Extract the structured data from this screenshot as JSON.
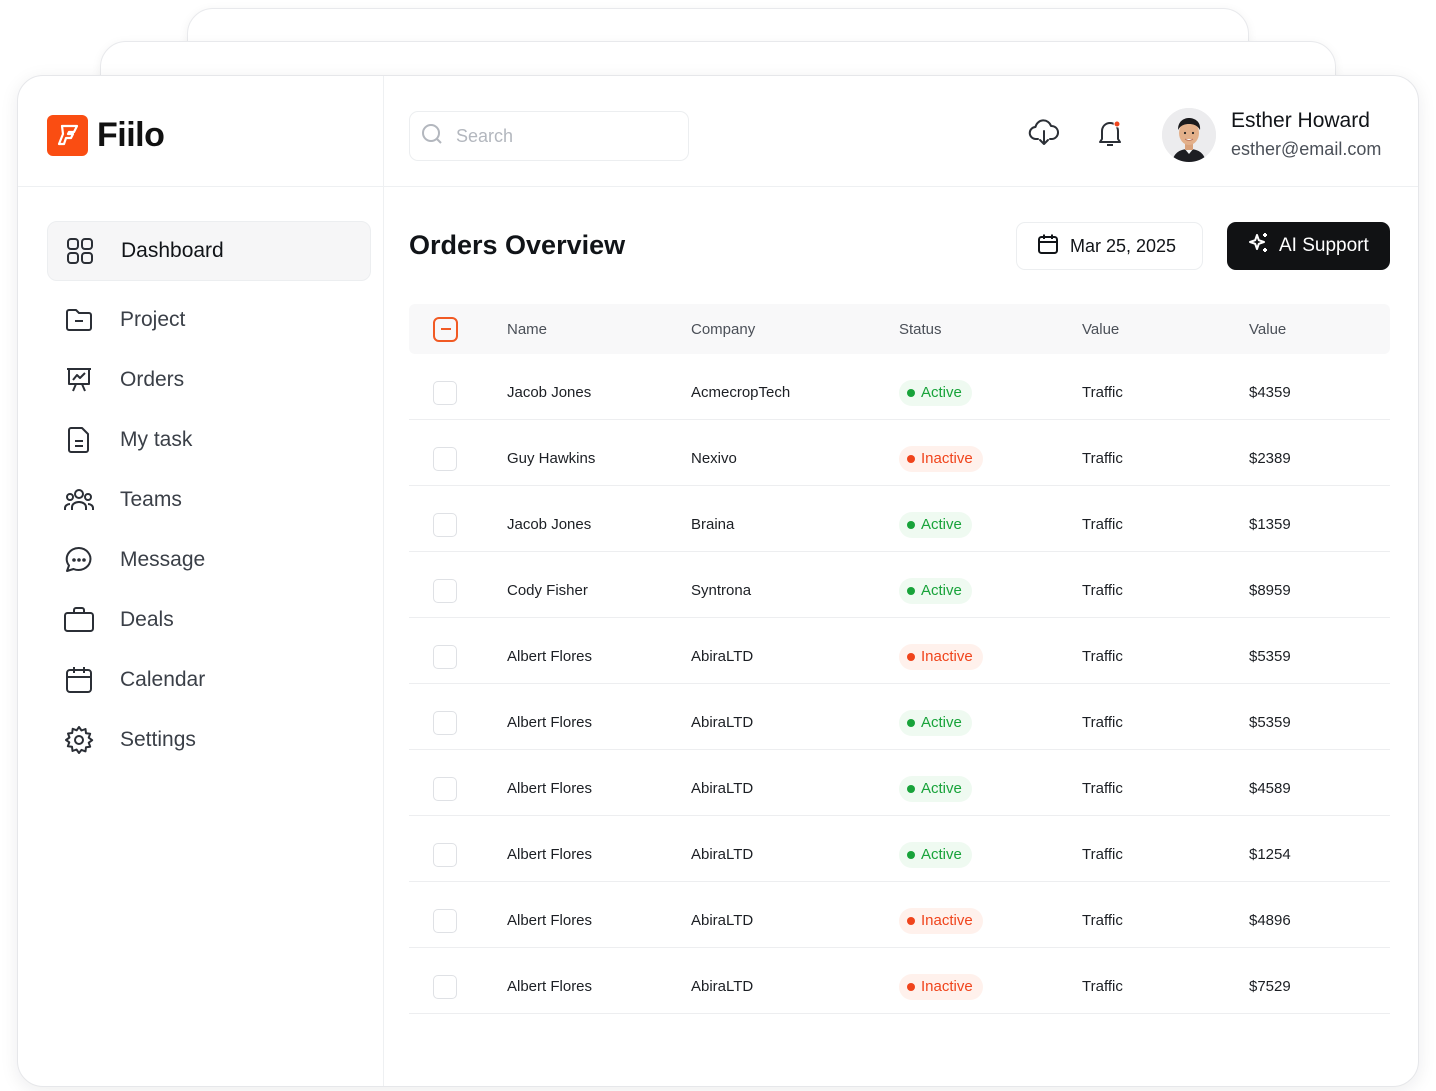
{
  "brand": {
    "name": "Fiilo",
    "accent": "#FA4D12"
  },
  "sidebar": {
    "items": [
      {
        "label": "Dashboard",
        "icon": "grid-icon",
        "active": true
      },
      {
        "label": "Project",
        "icon": "folder-icon"
      },
      {
        "label": "Orders",
        "icon": "presentation-chart-icon"
      },
      {
        "label": "My task",
        "icon": "document-icon"
      },
      {
        "label": "Teams",
        "icon": "users-icon"
      },
      {
        "label": "Message",
        "icon": "chat-bubble-icon"
      },
      {
        "label": "Deals",
        "icon": "briefcase-icon"
      },
      {
        "label": "Calendar",
        "icon": "calendar-icon"
      },
      {
        "label": "Settings",
        "icon": "gear-icon"
      }
    ]
  },
  "header": {
    "search": {
      "placeholder": "Search",
      "value": ""
    },
    "user": {
      "name": "Esther Howard",
      "email": "esther@email.com"
    }
  },
  "main": {
    "title": "Orders Overview",
    "date": "Mar 25, 2025",
    "ai_button": "AI Support",
    "table": {
      "columns": [
        "Name",
        "Company",
        "Status",
        "Value",
        "Value"
      ],
      "rows": [
        {
          "name": "Jacob Jones",
          "company": "AcmecropTech",
          "status": "Active",
          "type": "Traffic",
          "value": "$4359"
        },
        {
          "name": "Guy Hawkins",
          "company": "Nexivo",
          "status": "Inactive",
          "type": "Traffic",
          "value": "$2389"
        },
        {
          "name": "Jacob Jones",
          "company": "Braina",
          "status": "Active",
          "type": "Traffic",
          "value": "$1359"
        },
        {
          "name": "Cody Fisher",
          "company": "Syntrona",
          "status": "Active",
          "type": "Traffic",
          "value": "$8959"
        },
        {
          "name": "Albert Flores",
          "company": "AbiraLTD",
          "status": "Inactive",
          "type": "Traffic",
          "value": "$5359"
        },
        {
          "name": "Albert Flores",
          "company": "AbiraLTD",
          "status": "Active",
          "type": "Traffic",
          "value": "$5359"
        },
        {
          "name": "Albert Flores",
          "company": "AbiraLTD",
          "status": "Active",
          "type": "Traffic",
          "value": "$4589"
        },
        {
          "name": "Albert Flores",
          "company": "AbiraLTD",
          "status": "Active",
          "type": "Traffic",
          "value": "$1254"
        },
        {
          "name": "Albert Flores",
          "company": "AbiraLTD",
          "status": "Inactive",
          "type": "Traffic",
          "value": "$4896"
        },
        {
          "name": "Albert Flores",
          "company": "AbiraLTD",
          "status": "Inactive",
          "type": "Traffic",
          "value": "$7529"
        }
      ]
    }
  },
  "colors": {
    "active": "#18A33A",
    "inactive": "#F0441C",
    "dark_button": "#111214"
  }
}
